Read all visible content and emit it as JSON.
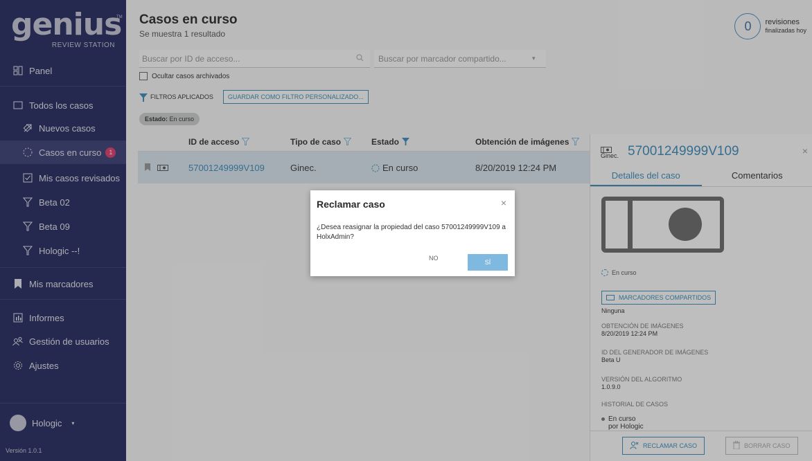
{
  "brand": {
    "word": "genius",
    "tm": "TM",
    "sub": "REVIEW STATION"
  },
  "sidebar": {
    "items": [
      {
        "label": "Panel",
        "icon": "dashboard-icon"
      },
      {
        "label": "Todos los casos",
        "icon": "folder-icon"
      },
      {
        "label": "Nuevos casos",
        "icon": "new-case-icon"
      },
      {
        "label": "Casos en curso",
        "icon": "in-progress-icon",
        "badge": "1"
      },
      {
        "label": "Mis casos revisados",
        "icon": "checkbox-icon"
      },
      {
        "label": "Beta 02",
        "icon": "filter-icon"
      },
      {
        "label": "Beta 09",
        "icon": "filter-icon"
      },
      {
        "label": "Hologic --!",
        "icon": "filter-icon"
      },
      {
        "label": "Mis marcadores",
        "icon": "bookmark-icon"
      },
      {
        "label": "Informes",
        "icon": "report-icon"
      },
      {
        "label": "Gestión de usuarios",
        "icon": "users-icon"
      },
      {
        "label": "Ajustes",
        "icon": "gear-icon"
      }
    ],
    "user": "Hologic",
    "version": "Versión 1.0.1"
  },
  "header": {
    "title": "Casos en curso",
    "subtitle": "Se muestra 1 resultado",
    "reviews_count": "0",
    "reviews_label_1": "revisiones",
    "reviews_label_2": "finalizadas hoy"
  },
  "search": {
    "placeholder": "Buscar por ID de acceso...",
    "marker_placeholder": "Buscar por marcador compartido..."
  },
  "filters": {
    "hide_archived": "Ocultar casos archivados",
    "applied_label": "FILTROS APLICADOS",
    "save_button": "GUARDAR COMO FILTRO PERSONALIZADO...",
    "chip_key": "Estado:",
    "chip_value": "En curso"
  },
  "table": {
    "headers": [
      "ID de acceso",
      "Tipo de caso",
      "Estado",
      "Obtención de imágenes"
    ],
    "rows": [
      {
        "id": "57001249999V109",
        "type": "Ginec.",
        "status": "En curso",
        "date": "8/20/2019 12:24 PM"
      }
    ]
  },
  "panel": {
    "case_id": "57001249999V109",
    "case_type": "Ginec.",
    "tabs": [
      "Detalles del caso",
      "Comentarios"
    ],
    "status": "En curso",
    "shared_markers_button": "MARCADORES COMPARTIDOS",
    "shared_markers_value": "Ninguna",
    "fields": [
      {
        "label": "OBTENCIÓN DE IMÁGENES",
        "value": "8/20/2019 12:24 PM"
      },
      {
        "label": "ID DEL GENERADOR DE IMÁGENES",
        "value": "Beta U"
      },
      {
        "label": "VERSIÓN DEL ALGORITMO",
        "value": "1.0.9.0"
      }
    ],
    "history_label": "HISTORIAL DE CASOS",
    "history_status": "En curso",
    "history_by": "por Hologic",
    "claim_button": "RECLAMAR CASO",
    "delete_button": "BORRAR CASO"
  },
  "modal": {
    "title": "Reclamar caso",
    "body": "¿Desea reasignar la propiedad del caso 57001249999V109 a HolxAdmin?",
    "no": "NO",
    "yes": "SÍ"
  },
  "colors": {
    "sidebar": "#252a60",
    "accent": "#3c8dbc",
    "badge": "#e23b6d",
    "row_selected": "#dbe8f3"
  }
}
